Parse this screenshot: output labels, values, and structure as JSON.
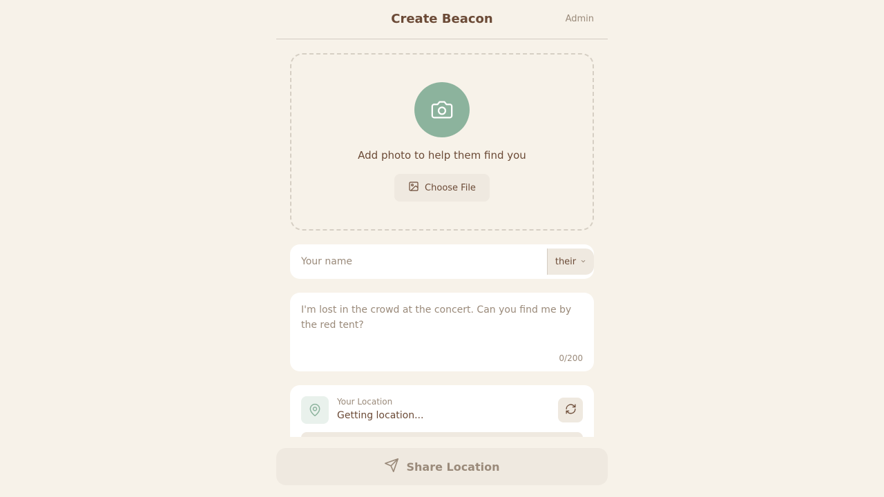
{
  "header": {
    "title": "Create Beacon",
    "admin_label": "Admin"
  },
  "photo": {
    "icon": "camera-icon",
    "prompt": "Add photo to help them find you",
    "choose_label": "Choose File",
    "choose_icon": "image-icon"
  },
  "name_field": {
    "placeholder": "Your name",
    "value": "",
    "pronoun": "their",
    "pronoun_icon": "chevron-down-icon"
  },
  "message": {
    "placeholder": "I'm lost in the crowd at the concert. Can you find me by the red tent?",
    "value": "",
    "counter": "0/200"
  },
  "location": {
    "icon": "map-pin-icon",
    "label": "Your Location",
    "value": "Getting location...",
    "refresh_icon": "refresh-icon"
  },
  "share": {
    "label": "Share Location",
    "icon": "send-icon"
  },
  "colors": {
    "background": "#f7f2e9",
    "accent": "#8cb39d",
    "text": "#6b4a36",
    "muted": "#9a8a7a",
    "surface": "#ffffff",
    "button": "#efe9e0"
  }
}
